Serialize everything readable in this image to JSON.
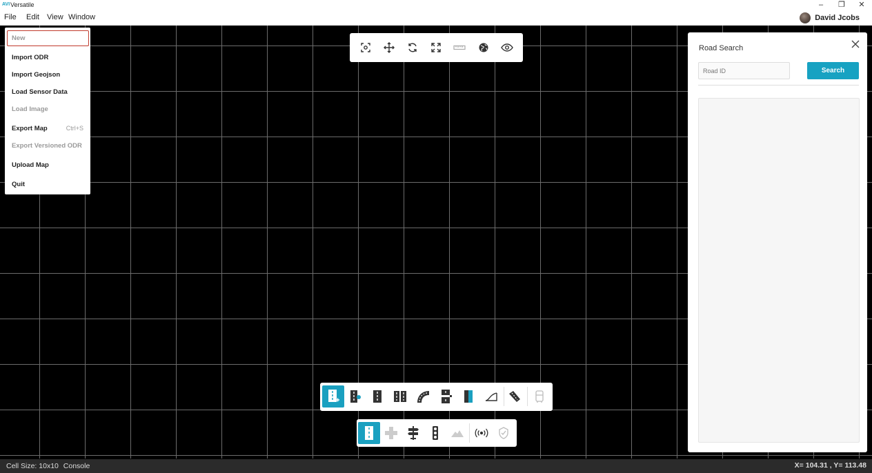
{
  "window": {
    "app_title": "Versatile",
    "logo_text": "AVI",
    "controls": {
      "minimize": "–",
      "restore": "❐",
      "close": "✕"
    }
  },
  "menubar": {
    "items": [
      "File",
      "Edit",
      "View",
      "Window"
    ],
    "user_name": "David Jcobs"
  },
  "file_menu": {
    "items": [
      {
        "label": "New",
        "disabled": true,
        "highlighted": true
      },
      {
        "label": "Import ODR",
        "disabled": false
      },
      {
        "label": "Import Geojson",
        "disabled": false
      },
      {
        "label": "Load Sensor Data",
        "disabled": false
      },
      {
        "label": "Load Image",
        "disabled": true
      },
      {
        "label": "Export Map",
        "disabled": false,
        "shortcut": "Ctrl+S"
      },
      {
        "label": "Export Versioned ODR",
        "disabled": true
      },
      {
        "label": "Upload Map",
        "disabled": false
      },
      {
        "label": "Quit",
        "disabled": false
      }
    ]
  },
  "top_toolbar": {
    "icons": [
      "focus-icon",
      "move-icon",
      "rotate-icon",
      "fit-screen-icon",
      "ruler-icon",
      "globe-icon",
      "eye-icon"
    ]
  },
  "bottom_toolbar_1": {
    "icons": [
      "add-road-icon",
      "road-link-icon",
      "road-lanes-icon",
      "multi-lane-icon",
      "curved-road-icon",
      "junction-road-icon",
      "road-marking-icon",
      "elevation-icon",
      "ramp-icon",
      "vehicle-icon"
    ],
    "active_index": 0
  },
  "bottom_toolbar_2": {
    "icons": [
      "single-road-icon",
      "intersection-icon",
      "signpost-icon",
      "traffic-light-icon",
      "terrain-icon",
      "sensor-signal-icon",
      "shield-check-icon"
    ],
    "active_index": 0
  },
  "road_search": {
    "title": "Road Search",
    "input_placeholder": "Road ID",
    "input_value": "",
    "search_label": "Search"
  },
  "statusbar": {
    "cell_size": "Cell Size: 10x10",
    "console_label": "Console",
    "coordinates": "X= 104.31 , Y= 113.48"
  },
  "colors": {
    "accent": "#17a2c2",
    "highlight_border": "#c0392b",
    "canvas_bg": "#000000",
    "grid_line": "#6c6c6c"
  }
}
